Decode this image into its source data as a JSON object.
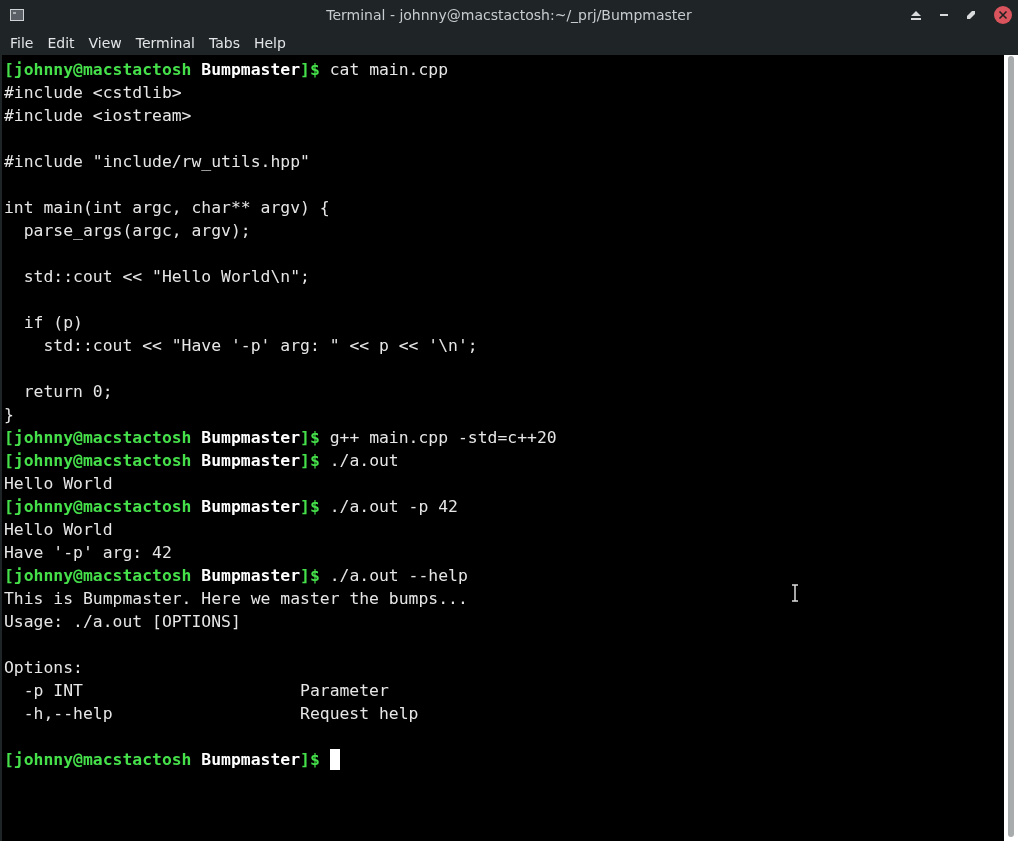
{
  "window": {
    "title": "Terminal - johnny@macstactosh:~/_prj/Bumpmaster"
  },
  "menu": [
    "File",
    "Edit",
    "View",
    "Terminal",
    "Tabs",
    "Help"
  ],
  "terminal": {
    "lines": [
      {
        "kind": "prompt",
        "user_host": "[johnny@macstactosh",
        "directory": "Bumpmaster",
        "symbol": "]$",
        "command": "cat main.cpp"
      },
      {
        "kind": "output",
        "text": "#include <cstdlib>"
      },
      {
        "kind": "output",
        "text": "#include <iostream>"
      },
      {
        "kind": "blank"
      },
      {
        "kind": "output",
        "text": "#include \"include/rw_utils.hpp\""
      },
      {
        "kind": "blank"
      },
      {
        "kind": "output",
        "text": "int main(int argc, char** argv) {"
      },
      {
        "kind": "output",
        "text": "  parse_args(argc, argv);"
      },
      {
        "kind": "blank"
      },
      {
        "kind": "output",
        "text": "  std::cout << \"Hello World\\n\";"
      },
      {
        "kind": "blank"
      },
      {
        "kind": "output",
        "text": "  if (p)"
      },
      {
        "kind": "output",
        "text": "    std::cout << \"Have '-p' arg: \" << p << '\\n';"
      },
      {
        "kind": "blank"
      },
      {
        "kind": "output",
        "text": "  return 0;"
      },
      {
        "kind": "output",
        "text": "}"
      },
      {
        "kind": "prompt",
        "user_host": "[johnny@macstactosh",
        "directory": "Bumpmaster",
        "symbol": "]$",
        "command": "g++ main.cpp -std=c++20"
      },
      {
        "kind": "prompt",
        "user_host": "[johnny@macstactosh",
        "directory": "Bumpmaster",
        "symbol": "]$",
        "command": "./a.out"
      },
      {
        "kind": "output",
        "text": "Hello World"
      },
      {
        "kind": "prompt",
        "user_host": "[johnny@macstactosh",
        "directory": "Bumpmaster",
        "symbol": "]$",
        "command": "./a.out -p 42"
      },
      {
        "kind": "output",
        "text": "Hello World"
      },
      {
        "kind": "output",
        "text": "Have '-p' arg: 42"
      },
      {
        "kind": "prompt",
        "user_host": "[johnny@macstactosh",
        "directory": "Bumpmaster",
        "symbol": "]$",
        "command": "./a.out --help"
      },
      {
        "kind": "output",
        "text": "This is Bumpmaster. Here we master the bumps..."
      },
      {
        "kind": "output",
        "text": "Usage: ./a.out [OPTIONS]"
      },
      {
        "kind": "blank"
      },
      {
        "kind": "output",
        "text": "Options:"
      },
      {
        "kind": "option",
        "flag": "-p INT",
        "description": "Parameter"
      },
      {
        "kind": "option",
        "flag": "-h,--help",
        "description": "Request help"
      },
      {
        "kind": "blank"
      },
      {
        "kind": "prompt",
        "user_host": "[johnny@macstactosh",
        "directory": "Bumpmaster",
        "symbol": "]$",
        "cursor": true
      }
    ]
  }
}
